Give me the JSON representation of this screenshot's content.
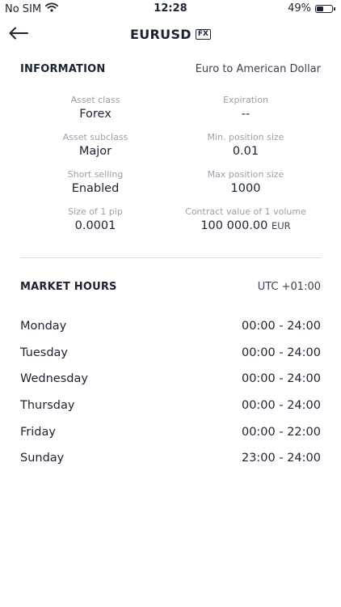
{
  "status_bar": {
    "carrier": "No SIM",
    "time": "12:28",
    "battery_percent": "49%",
    "battery_level": 0.49
  },
  "header": {
    "title": "EURUSD",
    "badge": "FX",
    "back_icon": "arrow-left-icon"
  },
  "information": {
    "title": "INFORMATION",
    "description": "Euro to American Dollar",
    "fields": [
      {
        "label": "Asset class",
        "value": "Forex",
        "unit": ""
      },
      {
        "label": "Expiration",
        "value": "--",
        "unit": ""
      },
      {
        "label": "Asset subclass",
        "value": "Major",
        "unit": ""
      },
      {
        "label": "Min. position size",
        "value": "0.01",
        "unit": ""
      },
      {
        "label": "Short selling",
        "value": "Enabled",
        "unit": ""
      },
      {
        "label": "Max position size",
        "value": "1000",
        "unit": ""
      },
      {
        "label": "Size of 1 pip",
        "value": "0.0001",
        "unit": ""
      },
      {
        "label": "Contract value of 1 volume",
        "value": "100 000.00",
        "unit": "EUR"
      }
    ]
  },
  "market_hours": {
    "title": "MARKET HOURS",
    "timezone": "UTC +01:00",
    "rows": [
      {
        "day": "Monday",
        "hours": "00:00 - 24:00"
      },
      {
        "day": "Tuesday",
        "hours": "00:00 - 24:00"
      },
      {
        "day": "Wednesday",
        "hours": "00:00 - 24:00"
      },
      {
        "day": "Thursday",
        "hours": "00:00 - 24:00"
      },
      {
        "day": "Friday",
        "hours": "00:00 - 22:00"
      },
      {
        "day": "Sunday",
        "hours": "23:00 - 24:00"
      }
    ]
  }
}
